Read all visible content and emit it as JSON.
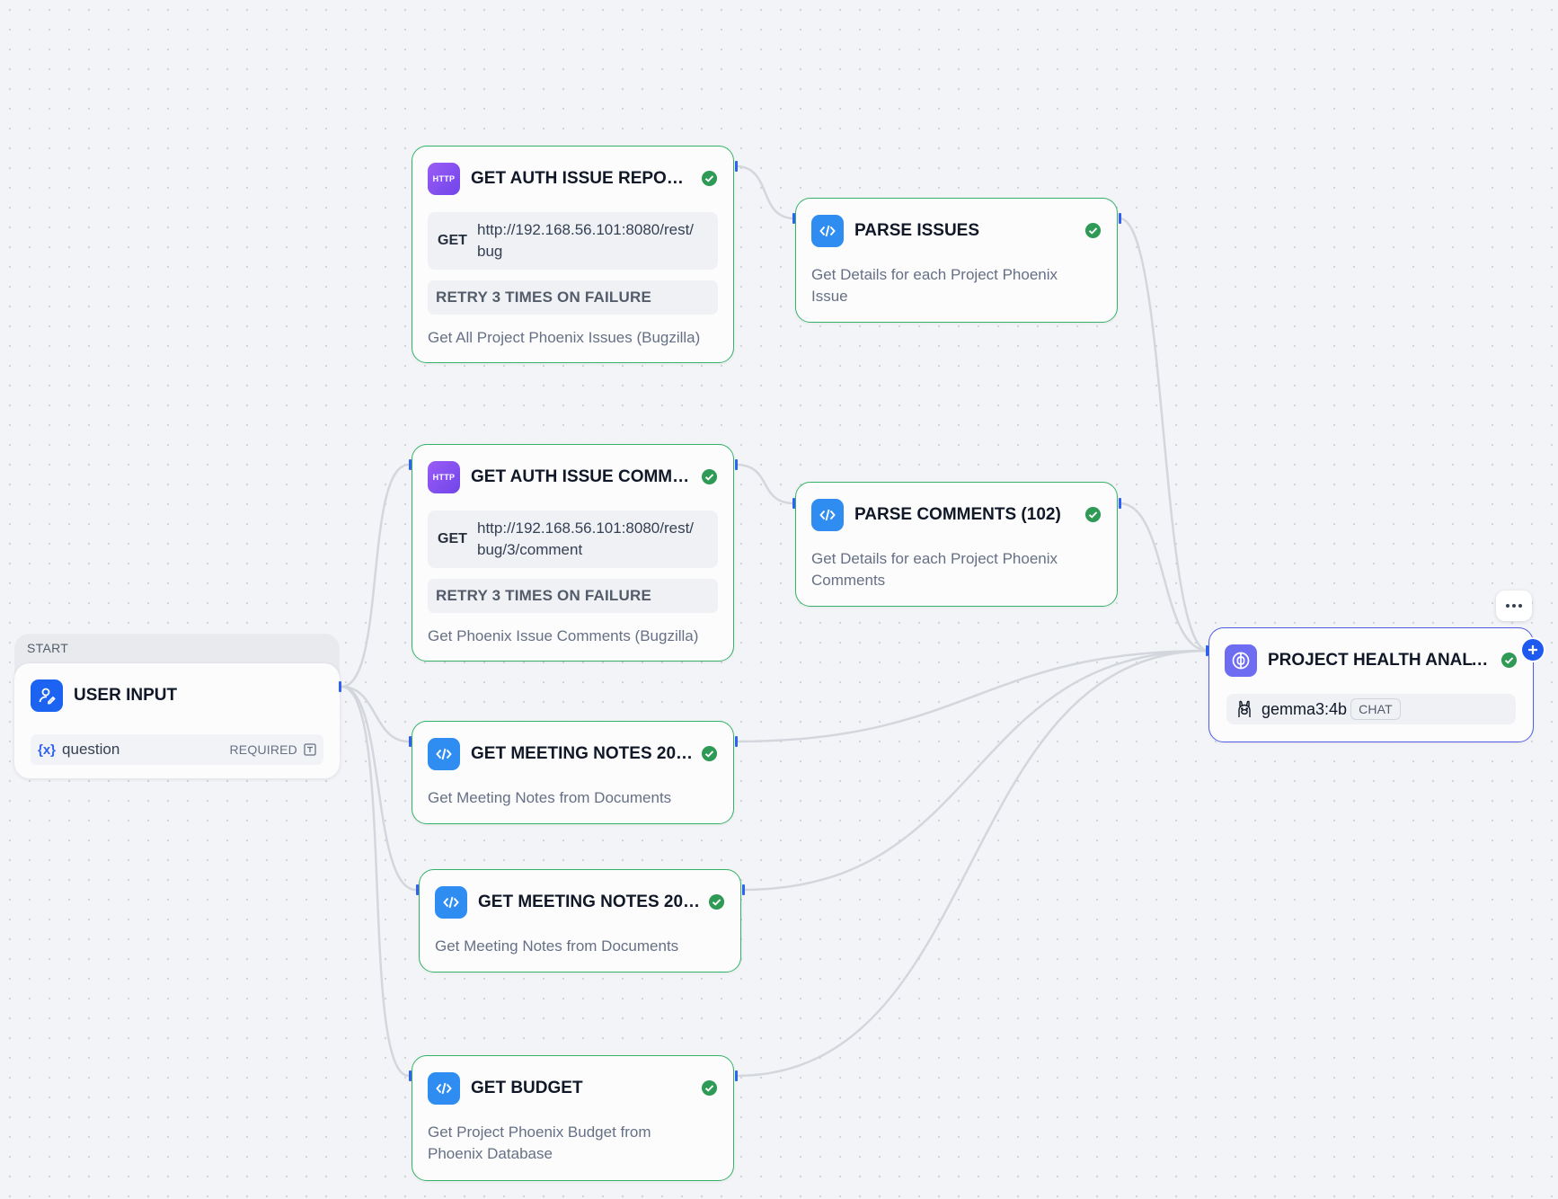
{
  "start": {
    "section_label": "START",
    "title": "USER INPUT",
    "variable": {
      "symbol": "{x}",
      "name": "question",
      "badge": "REQUIRED"
    }
  },
  "nodes": {
    "auth_reports": {
      "icon_text": "HTTP",
      "title": "GET AUTH ISSUE REPORTS",
      "method": "GET",
      "url": "http://192.168.56.101:8080/rest/bug",
      "retry": "RETRY 3 TIMES ON FAILURE",
      "description": "Get All Project Phoenix Issues (Bugzilla)"
    },
    "auth_comments": {
      "icon_text": "HTTP",
      "title": "GET AUTH ISSUE COMME...",
      "method": "GET",
      "url": "http://192.168.56.101:8080/rest/bug/3/comment",
      "retry": "RETRY 3 TIMES ON FAILURE",
      "description": "Get Phoenix Issue Comments (Bugzilla)"
    },
    "meeting_notes_1": {
      "title": "GET MEETING NOTES 202...",
      "description": "Get Meeting Notes from Documents"
    },
    "meeting_notes_2": {
      "title": "GET MEETING NOTES 202...",
      "description": "Get Meeting Notes from Documents"
    },
    "budget": {
      "title": "GET BUDGET",
      "description": "Get Project Phoenix Budget from Phoenix Database"
    },
    "parse_issues": {
      "title": "PARSE ISSUES",
      "description": "Get Details for each Project Phoenix Issue"
    },
    "parse_comments": {
      "title": "PARSE COMMENTS (102)",
      "description": "Get Details for each Project Phoenix Comments"
    },
    "health_analysis": {
      "title": "PROJECT HEALTH ANALY...",
      "model": "gemma3:4b",
      "mode": "CHAT"
    }
  },
  "icons": {
    "http": "http-icon",
    "code": "code-icon",
    "llm": "brain-icon",
    "user": "user-edit-icon",
    "status": "check-circle-icon",
    "model": "ollama-icon"
  },
  "colors": {
    "success_border": "#34b368",
    "success_check": "#2e9a55",
    "llm_border": "#4f5ce6",
    "edge": "#d3d6dc",
    "port": "#2f62f0",
    "canvas": "#f3f4f7"
  }
}
